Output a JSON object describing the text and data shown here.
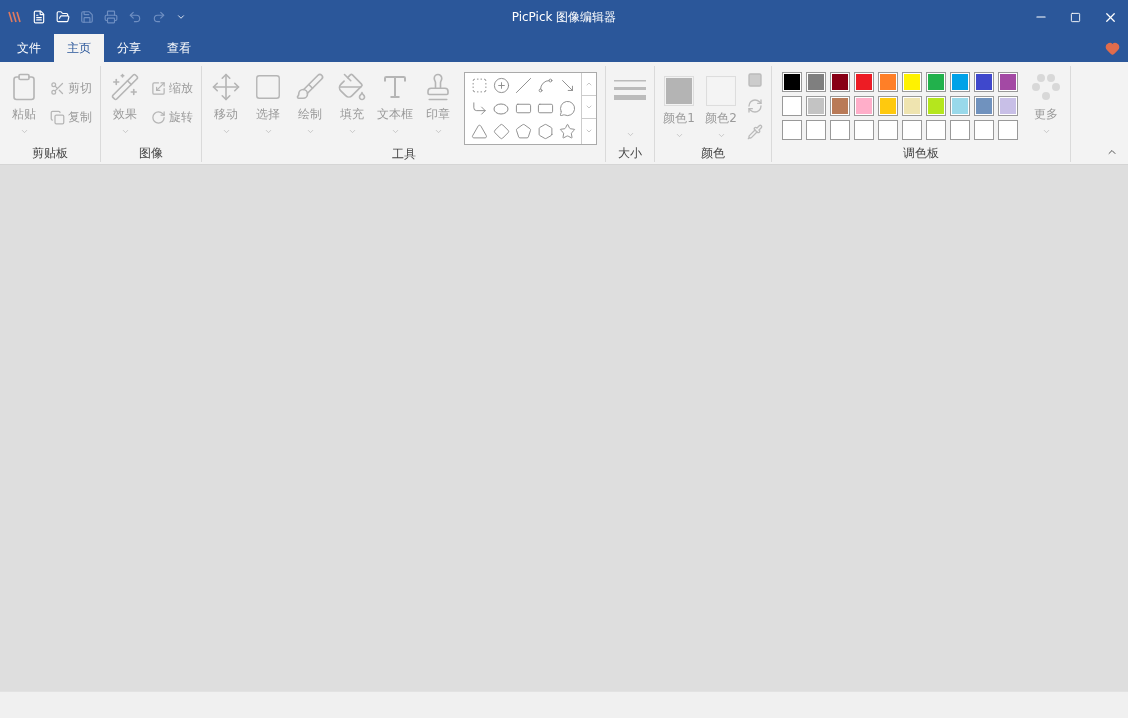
{
  "window": {
    "title": "PicPick 图像编辑器"
  },
  "quick_access": [
    {
      "disabled": false
    },
    {
      "disabled": false
    },
    {
      "disabled": true
    },
    {
      "disabled": true
    },
    {
      "disabled": true
    },
    {
      "disabled": true
    }
  ],
  "tabs": [
    {
      "label": "文件",
      "selected": false
    },
    {
      "label": "主页",
      "selected": true
    },
    {
      "label": "分享",
      "selected": false
    },
    {
      "label": "查看",
      "selected": false
    }
  ],
  "ribbon": {
    "groups": [
      {
        "label": "剪贴板",
        "items": [
          {
            "kind": "large",
            "label": "粘贴",
            "disabled": true
          },
          {
            "kind": "small",
            "label": "剪切",
            "disabled": true
          },
          {
            "kind": "small",
            "label": "复制",
            "disabled": true
          }
        ]
      },
      {
        "label": "图像",
        "items": [
          {
            "kind": "large",
            "label": "效果",
            "disabled": true
          },
          {
            "kind": "small",
            "label": "缩放",
            "disabled": true
          },
          {
            "kind": "small",
            "label": "旋转",
            "disabled": true
          }
        ]
      },
      {
        "label": "工具",
        "items": [
          {
            "kind": "large",
            "label": "移动",
            "disabled": true
          },
          {
            "kind": "large",
            "label": "选择",
            "disabled": true
          },
          {
            "kind": "large",
            "label": "绘制",
            "disabled": true
          },
          {
            "kind": "large",
            "label": "填充",
            "disabled": true
          },
          {
            "kind": "large",
            "label": "文本框",
            "disabled": true
          },
          {
            "kind": "large",
            "label": "印章",
            "disabled": true
          },
          {
            "kind": "gallery"
          }
        ]
      },
      {
        "label": "大小",
        "items": [
          {
            "kind": "size"
          }
        ]
      },
      {
        "label": "颜色",
        "items": [
          {
            "kind": "swatch",
            "label": "颜色1",
            "color": "#b4b4b4",
            "disabled": true
          },
          {
            "kind": "swatch",
            "label": "颜色2",
            "color": "#f4f4f4",
            "disabled": true
          },
          {
            "kind": "tools"
          }
        ]
      },
      {
        "label": "调色板",
        "items": [
          {
            "kind": "palette",
            "colors": [
              {
                "color": "#000000"
              },
              {
                "color": "#7f7f7f"
              },
              {
                "color": "#880015"
              },
              {
                "color": "#ed1c24"
              },
              {
                "color": "#ff7f27"
              },
              {
                "color": "#fff200"
              },
              {
                "color": "#22b14c"
              },
              {
                "color": "#00a2e8"
              },
              {
                "color": "#3f48cc"
              },
              {
                "color": "#a349a4"
              },
              {
                "color": "#ffffff"
              },
              {
                "color": "#c3c3c3"
              },
              {
                "color": "#b97a57"
              },
              {
                "color": "#ffaec9"
              },
              {
                "color": "#ffc90e"
              },
              {
                "color": "#efe4b0"
              },
              {
                "color": "#b5e61d"
              },
              {
                "color": "#99d9ea"
              },
              {
                "color": "#7092be"
              },
              {
                "color": "#c8bfe7"
              }
            ]
          },
          {
            "kind": "large",
            "label": "更多",
            "disabled": true
          }
        ]
      }
    ]
  }
}
